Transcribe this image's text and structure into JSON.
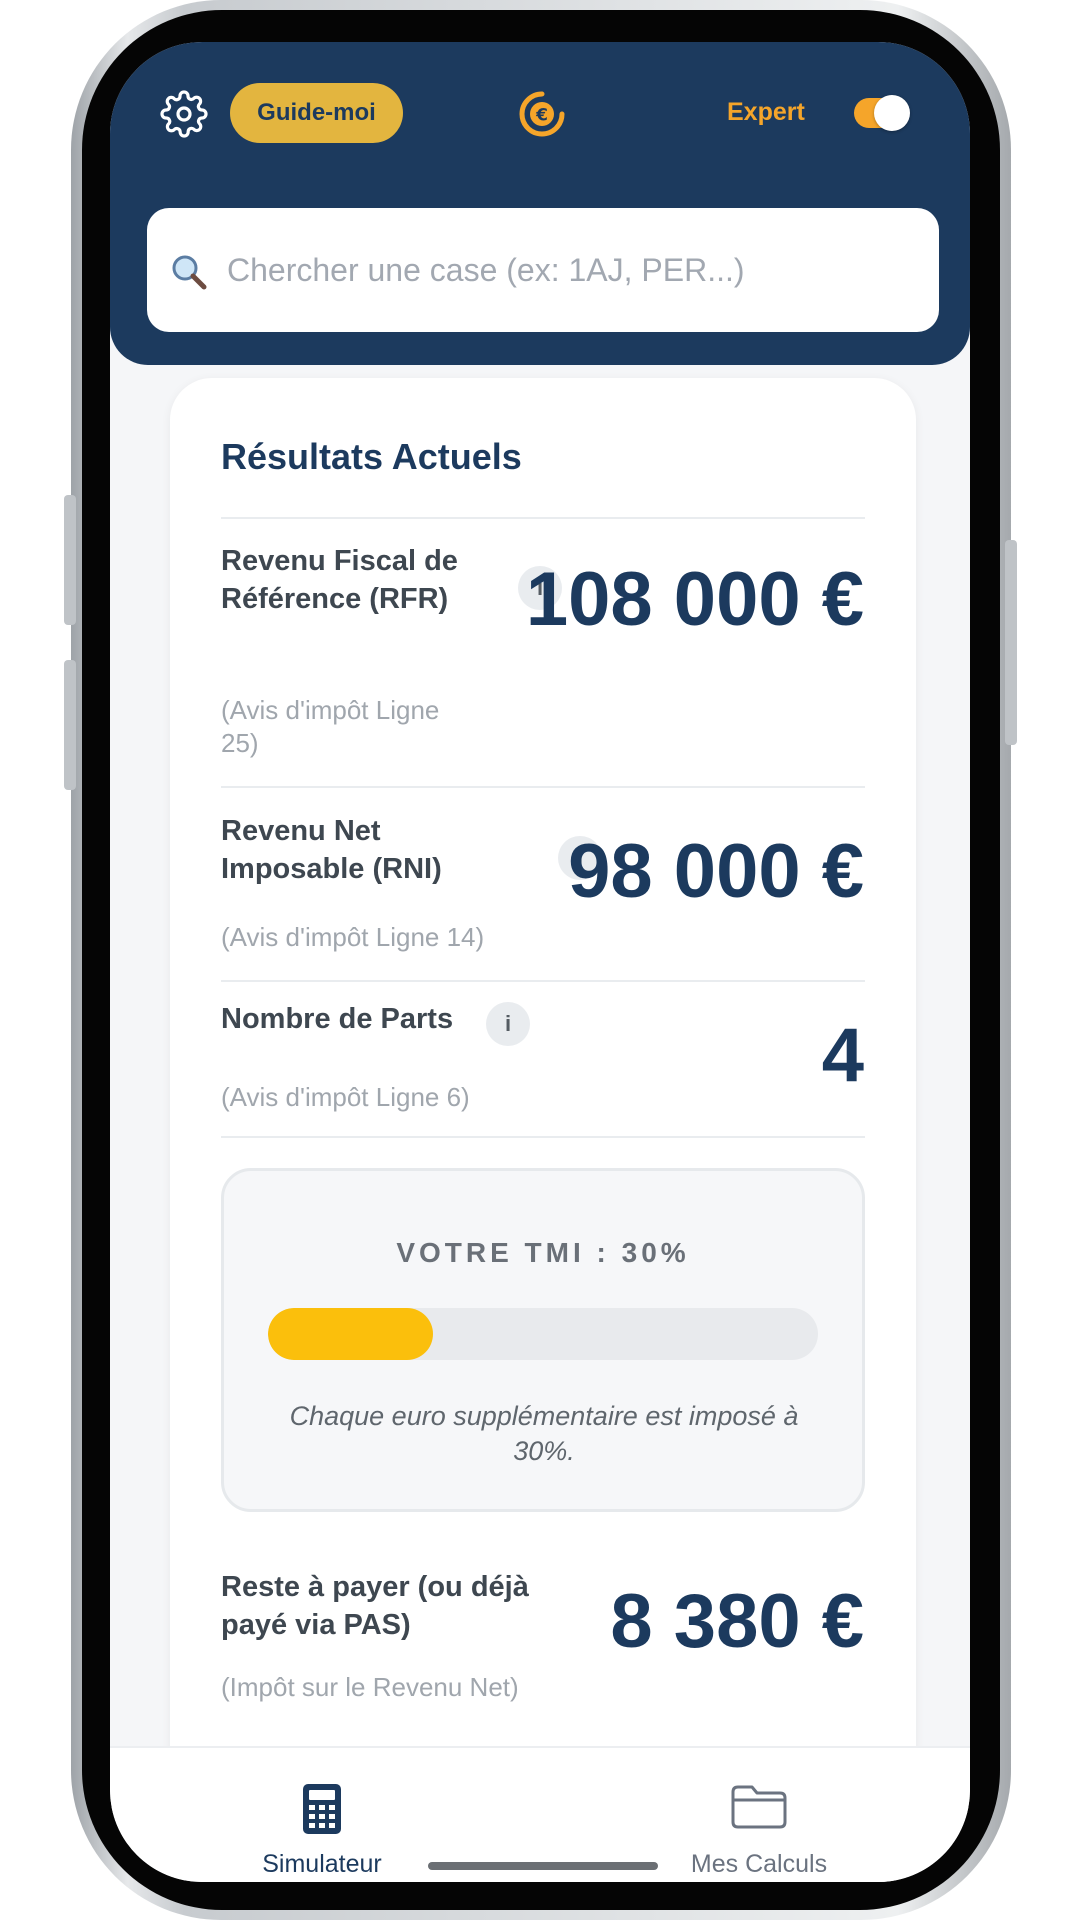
{
  "header": {
    "guide_label": "Guide-moi",
    "expert_label": "Expert",
    "expert_toggle_on": true
  },
  "search": {
    "placeholder": "Chercher une case (ex: 1AJ, PER...)",
    "value": ""
  },
  "results": {
    "title": "Résultats Actuels",
    "rows": [
      {
        "label": "Revenu Fiscal de Référence (RFR)",
        "sub": "(Avis d'impôt Ligne 25)",
        "value": "108 000 €",
        "info": "i"
      },
      {
        "label": "Revenu Net Imposable (RNI)",
        "sub": "(Avis d'impôt Ligne 14)",
        "value": "98 000 €",
        "info": "i"
      },
      {
        "label": "Nombre de Parts",
        "sub": "(Avis d'impôt Ligne 6)",
        "value": "4",
        "info": "i"
      }
    ],
    "tmi": {
      "title": "VOTRE TMI : 30%",
      "level_percent": 30,
      "note": "Chaque euro supplémentaire est imposé à 30%."
    },
    "remaining": {
      "label": "Reste à payer (ou déjà payé via PAS)",
      "sub": "(Impôt sur le Revenu Net)",
      "value": "8 380 €"
    }
  },
  "nav": {
    "simulator_label": "Simulateur",
    "calculs_label": "Mes Calculs"
  },
  "colors": {
    "primary": "#1c3a5e",
    "accent": "#e3b53f",
    "orange": "#f5a52a",
    "bar_fill": "#fbbf0c"
  }
}
